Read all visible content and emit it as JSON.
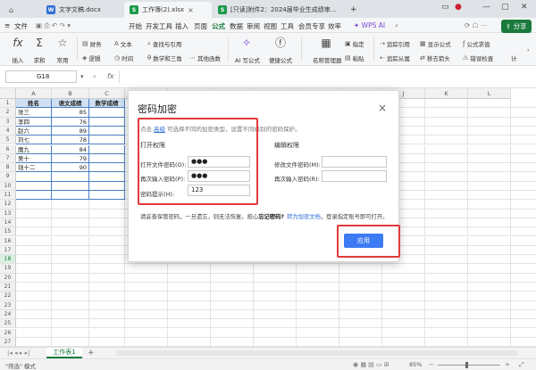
{
  "titlebar": {
    "tabs": [
      {
        "icon": "W",
        "color": "#2f6fd6",
        "label": "文字文稿.docx"
      },
      {
        "icon": "S",
        "color": "#1c9a4a",
        "label": "工作簿(2).xlsx"
      },
      {
        "icon": "S",
        "color": "#1c9a4a",
        "label": "[只读]附件2：2024届毕业生成绩审..."
      }
    ],
    "new_tab": "+"
  },
  "menubar": {
    "file": "文件",
    "items": [
      "开始",
      "开发工具",
      "插入",
      "页面",
      "公式",
      "数据",
      "审阅",
      "视图",
      "工具",
      "会员专享",
      "效率"
    ],
    "active": "公式",
    "wps_ai": "WPS AI",
    "share": "分享"
  },
  "ribbon": {
    "insert_func": "插入",
    "sum": "求和",
    "common": "常用",
    "finance": "财务",
    "logic": "逻辑",
    "text": "文本",
    "time": "时间",
    "lookup": "查找与引用",
    "math": "数学和三角",
    "other": "其他函数",
    "ai_formula": "AI 写公式",
    "quick_formula": "便捷公式",
    "name_mgr": "名称管理器",
    "specify": "指定",
    "paste": "粘贴",
    "trace_prec": "追踪引用",
    "trace_dep": "追踪从属",
    "show_formula": "显示公式",
    "remove_arrow": "移去箭头",
    "formula_eval": "公式求值",
    "error_check": "错误检查",
    "calc": "计"
  },
  "formulabar": {
    "cell_ref": "G18",
    "fx": "fx"
  },
  "grid": {
    "columns": [
      "A",
      "B",
      "C",
      "D",
      "E",
      "F",
      "G",
      "H",
      "I",
      "J",
      "K",
      "L"
    ],
    "rows": [
      "1",
      "2",
      "3",
      "4",
      "5",
      "6",
      "7",
      "8",
      "9",
      "10",
      "11",
      "12",
      "13",
      "14",
      "15",
      "16",
      "17",
      "18",
      "19",
      "20",
      "21",
      "22",
      "23",
      "24",
      "25",
      "26",
      "27"
    ],
    "header": {
      "name": "姓名",
      "chinese": "语文成绩",
      "math": "数学成绩"
    },
    "data": [
      {
        "name": "张三",
        "score": "85"
      },
      {
        "name": "李四",
        "score": "76"
      },
      {
        "name": "赵六",
        "score": "89"
      },
      {
        "name": "刘七",
        "score": "78"
      },
      {
        "name": "魔九",
        "score": "84"
      },
      {
        "name": "吴十",
        "score": "79"
      },
      {
        "name": "钱十二",
        "score": "90"
      }
    ]
  },
  "dialog": {
    "title": "密码加密",
    "hint_prefix": "点击",
    "hint_link": "高级",
    "hint_suffix": "可选择不同的加密类型，设置不同级别的密码保护。",
    "open_section": "打开权限",
    "open_pwd_label": "打开文件密码(O):",
    "open_pwd_value": "●●●",
    "open_confirm_label": "再次输入密码(P):",
    "open_confirm_value": "●●●",
    "hint_label": "密码提示(H):",
    "hint_value": "123",
    "edit_section": "编辑权限",
    "edit_pwd_label": "修改文件密码(M):",
    "edit_confirm_label": "再次输入密码(R):",
    "notice_prefix": "请妥善保管密码，一旦遗忘，则无法恢复。担心",
    "notice_bold": "忘记密码?",
    "notice_link": "转为加密文档",
    "notice_suffix": "，登录指定账号即可打开。",
    "apply": "应用",
    "close": "×"
  },
  "sheetbar": {
    "sheet": "工作表1",
    "add": "+"
  },
  "statusbar": {
    "filter": "\"筛选\" 模式",
    "zoom": "85%"
  },
  "colors": {
    "accent_green": "#1a7a3c",
    "apply_blue": "#3d7bf4",
    "highlight_red": "#e23b3b",
    "link_blue": "#2f6fd6"
  }
}
